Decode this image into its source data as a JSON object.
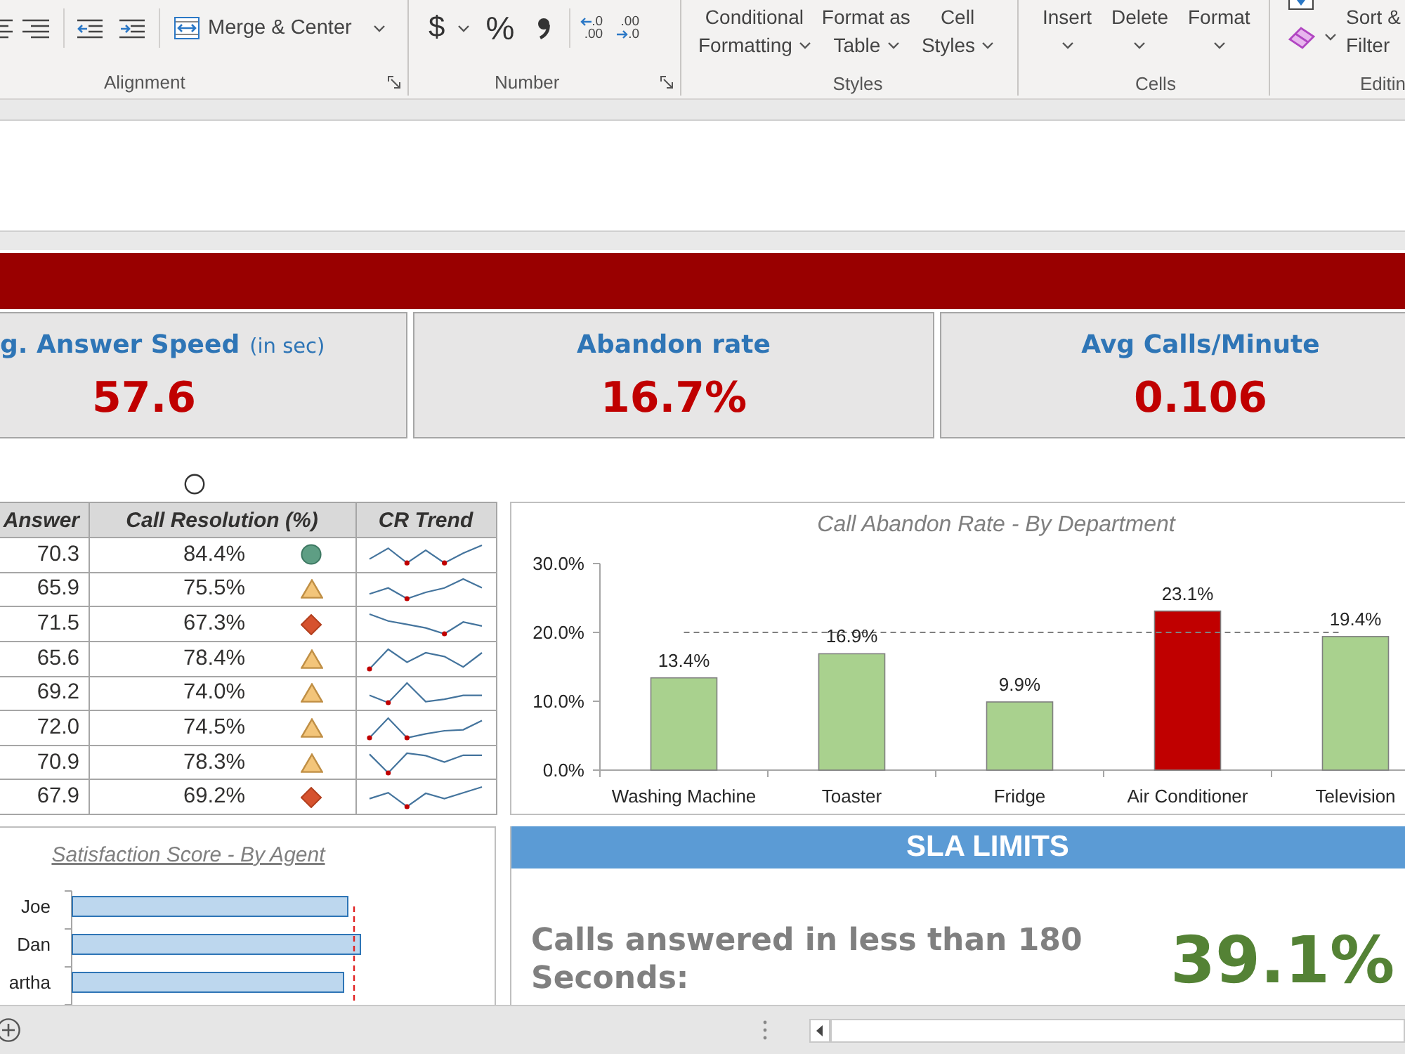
{
  "ribbon": {
    "alignment": {
      "label": "Alignment",
      "merge_button": "Merge & Center"
    },
    "number": {
      "label": "Number",
      "currency_button": "$",
      "percent_button": "%",
      "decimal_buttons": [
        {
          "kind": "increase",
          "top": ".0",
          "bottom": ".00"
        },
        {
          "kind": "decrease",
          "top": ".00",
          "bottom": ".0"
        }
      ]
    },
    "styles": {
      "label": "Styles",
      "buttons": [
        {
          "line_1": "Conditional",
          "line_2": "Formatting"
        },
        {
          "line_1": "Format as",
          "line_2": "Table"
        },
        {
          "line_1": "Cell",
          "line_2": "Styles"
        }
      ]
    },
    "cells": {
      "label": "Cells",
      "buttons": [
        "Insert",
        "Delete",
        "Format"
      ]
    },
    "editing": {
      "label": "Editin",
      "sort_filter_button": {
        "line_1": "Sort &",
        "line_2": "Filter"
      }
    }
  },
  "kpis": [
    {
      "title": "g. Answer Speed",
      "unit": "(in sec)",
      "value": "57.6"
    },
    {
      "title": "Abandon rate",
      "value": "16.7%"
    },
    {
      "title": "Avg Calls/Minute",
      "value": "0.106"
    }
  ],
  "table": {
    "columns": [
      "Answer",
      "Call Resolution (%)",
      "CR Trend"
    ],
    "rows": [
      {
        "column_1": "70.3",
        "call_resolution": "84.4%",
        "kind": "circle"
      },
      {
        "column_1": "65.9",
        "call_resolution": "75.5%",
        "kind": "triangle"
      },
      {
        "column_1": "71.5",
        "call_resolution": "67.3%",
        "kind": "diamond"
      },
      {
        "column_1": "65.6",
        "call_resolution": "78.4%",
        "kind": "triangle"
      },
      {
        "column_1": "69.2",
        "call_resolution": "74.0%",
        "kind": "triangle"
      },
      {
        "column_1": "72.0",
        "call_resolution": "74.5%",
        "kind": "triangle"
      },
      {
        "column_1": "70.9",
        "call_resolution": "78.3%",
        "kind": "triangle"
      },
      {
        "column_1": "67.9",
        "call_resolution": "69.2%",
        "kind": "diamond"
      }
    ]
  },
  "abandon_chart": {
    "chart_data": {
      "type": "bar",
      "title": "Call Abandon Rate - By Department",
      "categories": [
        "Washing Machine",
        "Toaster",
        "Fridge",
        "Air Conditioner",
        "Television"
      ],
      "values": [
        13.4,
        16.9,
        9.9,
        23.1,
        19.4
      ],
      "colors": [
        "#a9d18e",
        "#a9d18e",
        "#a9d18e",
        "#c00000",
        "#a9d18e"
      ],
      "ylim": [
        0,
        30
      ],
      "yticks": [
        {
          "value": 0,
          "label": "0.0%"
        },
        {
          "value": 10,
          "label": "10.0%"
        },
        {
          "value": 20,
          "label": "20.0%"
        },
        {
          "value": 30,
          "label": "30.0%"
        }
      ],
      "value_labels": [
        "13.4%",
        "16.9%",
        "9.9%",
        "23.1%",
        "19.4%"
      ]
    }
  },
  "satisfaction_chart": {
    "title": "Satisfaction Score - By Agent",
    "agents": [
      "Joe",
      "Dan",
      "artha"
    ]
  },
  "sla_panel": {
    "title": "SLA LIMITS",
    "metric_label": "Calls answered in less than 180 Seconds:",
    "metric_value": "39.1%"
  }
}
